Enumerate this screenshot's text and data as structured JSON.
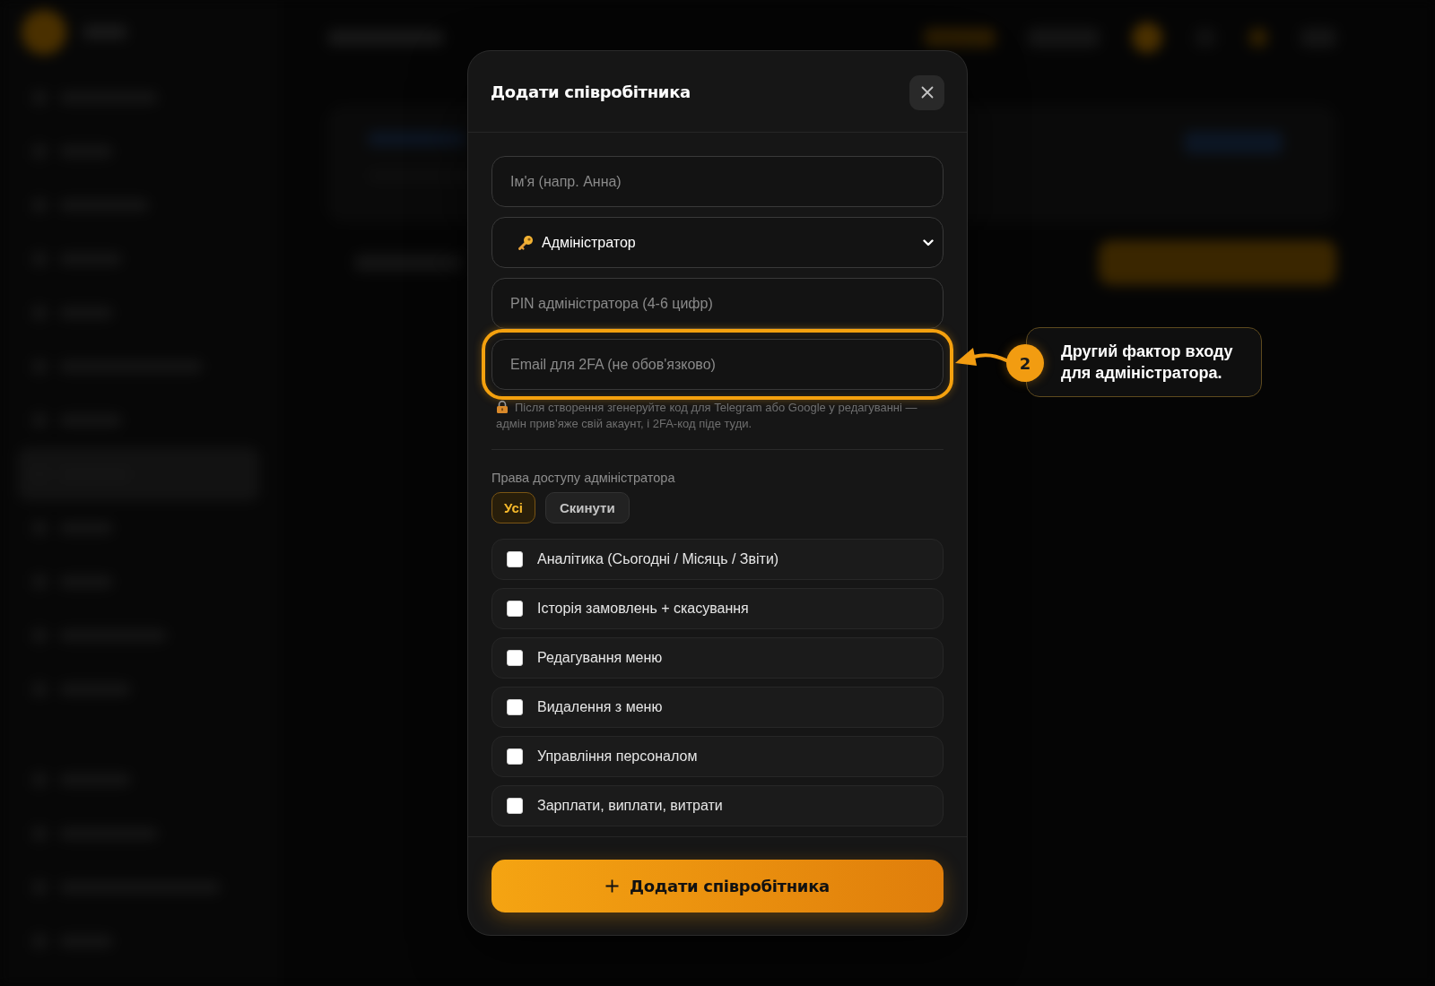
{
  "dialog": {
    "title": "Додати співробітника",
    "fields": [
      {
        "kind": "text",
        "placeholder": "Ім'я (напр. Анна)",
        "highlighted": false
      },
      {
        "kind": "select",
        "value": "Адміністратор",
        "highlighted": false
      },
      {
        "kind": "text",
        "placeholder": "PIN адміністратора (4-6 цифр)",
        "highlighted": false
      },
      {
        "kind": "text",
        "placeholder": "Email для 2FA (не обов'язково)",
        "highlighted": true
      }
    ],
    "hint": "Після створення згенеруйте код для Telegram або Google у редагуванні — адмін прив’яже свій акаунт, і 2FA-код піде туди.",
    "permissions": {
      "label": "Права доступу адміністратора",
      "actions": [
        {
          "label": "Усі",
          "kind": "accent"
        },
        {
          "label": "Скинути",
          "kind": "plain"
        }
      ],
      "items": [
        {
          "label": "Аналітика (Сьогодні / Місяць / Звіти)",
          "checked": false
        },
        {
          "label": "Історія замовлень + скасування",
          "checked": false
        },
        {
          "label": "Редагування меню",
          "checked": false
        },
        {
          "label": "Видалення з меню",
          "checked": false
        },
        {
          "label": "Управління персоналом",
          "checked": false
        },
        {
          "label": "Зарплати, виплати, витрати",
          "checked": false
        }
      ]
    },
    "submit": "Додати співробітника"
  },
  "callout": {
    "step": "2",
    "text": "Другий фактор входу для адміністратора."
  }
}
